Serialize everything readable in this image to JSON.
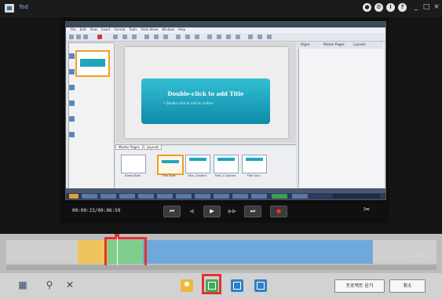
{
  "app": {
    "title": "Tod"
  },
  "window_controls": {
    "help": "?",
    "minimize": "_",
    "maximize": "□",
    "close": "×"
  },
  "inner_app": {
    "menu": [
      "File",
      "Edit",
      "View",
      "Insert",
      "Format",
      "Tools",
      "Slide Show",
      "Window",
      "Help"
    ],
    "right_tabs": [
      "Pages",
      "Master Pages",
      "Layouts"
    ],
    "layout_tabs": [
      "Master Pages",
      "Layouts"
    ],
    "slide": {
      "title": "Double-click to add Title",
      "subtitle": "• Double-click to add an outline"
    },
    "layout_labels": [
      "Blank Slide",
      "Title Slide",
      "Title, Content",
      "Title, 2 Content",
      "Title Only"
    ]
  },
  "player": {
    "timecode": "00:00:23/00:06:59",
    "buttons": [
      "⏮",
      "◀",
      "▶",
      "▶▶",
      "⏭",
      "●"
    ],
    "scissors": "✂"
  },
  "timeline": {
    "ghost_label": "⟨ ⟩ ⟨"
  },
  "bottom_bar": {
    "left_icons": [
      "film-icon",
      "search-icon",
      "delete-icon"
    ],
    "confirm_label": "프로젝트 닫기",
    "cancel_label": "취소"
  },
  "colors": {
    "accent_red": "#e2332e",
    "yellow": "#efc45d",
    "green": "#7fce8c",
    "blue": "#6fa9dc"
  }
}
